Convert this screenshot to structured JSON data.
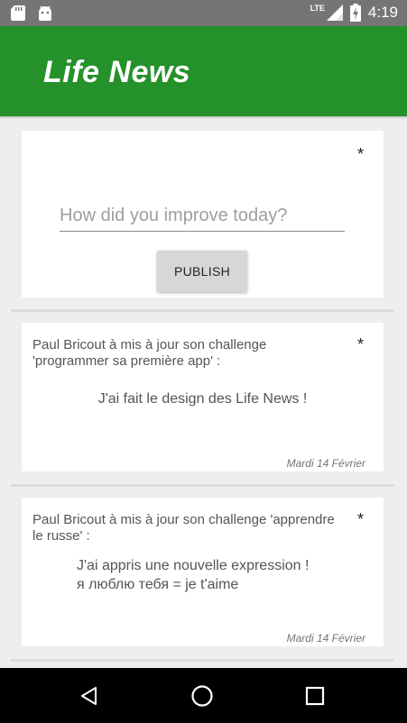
{
  "status_bar": {
    "network": "LTE",
    "time": "4:19"
  },
  "app_bar": {
    "title": "Life News"
  },
  "compose": {
    "star": "*",
    "placeholder": "How did you improve today?",
    "publish_label": "PUBLISH"
  },
  "posts": [
    {
      "star": "*",
      "header": "Paul Bricout à mis à jour son challenge 'programmer sa première app' :",
      "body_lines": [
        "J'ai fait le design des Life News !"
      ],
      "date": "Mardi 14 Février"
    },
    {
      "star": "*",
      "header": "Paul Bricout à mis à jour son challenge 'apprendre le russe' :",
      "body_lines": [
        "J'ai appris une nouvelle expression !",
        "я люблю тебя = je t'aime"
      ],
      "date": "Mardi 14 Février"
    }
  ],
  "nav_bar": {
    "icons": [
      "back-icon",
      "home-icon",
      "recents-icon"
    ]
  }
}
